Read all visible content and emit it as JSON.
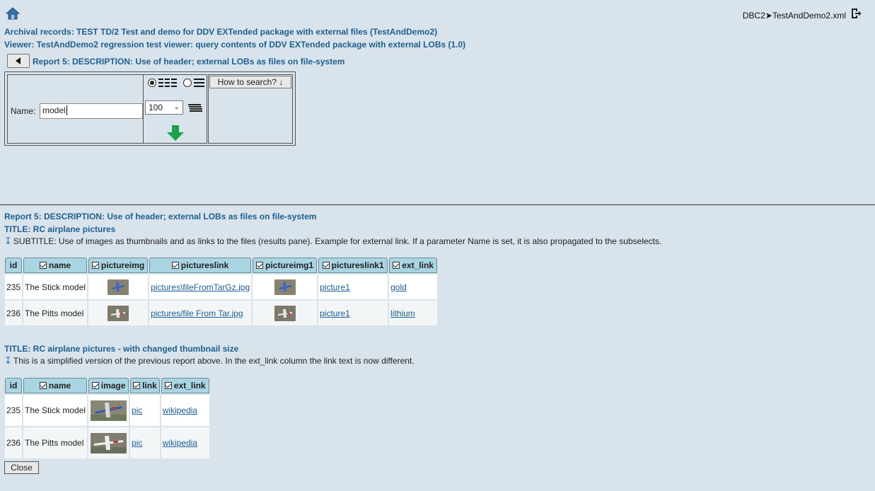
{
  "breadcrumb": "DBC2➤TestAndDemo2.xml",
  "header": {
    "archival": "Archival records: TEST TD/2 Test and demo for DDV EXTended package with external files (TestAndDemo2)",
    "viewer": "Viewer: TestAndDemo2 regression test viewer: query contents of DDV EXTended package with external LOBs (1.0)",
    "report": "Report 5: DESCRIPTION: Use of header; external LOBs as files on file-system"
  },
  "search": {
    "name_label": "Name:",
    "name_value": "model",
    "rows_selected": "100",
    "howto_label": "How to search? ↓"
  },
  "results": {
    "report": "Report 5: DESCRIPTION: Use of header; external LOBs as files on file-system",
    "table1": {
      "title": "TITLE: RC airplane pictures",
      "subtitle": "SUBTITLE: Use of images as thumbnails and as links to the files (results pane). Example for external link. If a parameter Name is set, it is also propagated to the subselects.",
      "columns": [
        "id",
        "name",
        "pictureimg",
        "pictureslink",
        "pictureimg1",
        "pictureslink1",
        "ext_link"
      ],
      "rows": [
        {
          "id": "235",
          "name": "The Stick model",
          "pictureslink": "pictures\\fileFromTarGz.jpg",
          "pictureslink1": "picture1",
          "ext_link": "gold"
        },
        {
          "id": "236",
          "name": "The Pitts model",
          "pictureslink": "pictures/file From Tar.jpg",
          "pictureslink1": "picture1",
          "ext_link": "lithium"
        }
      ]
    },
    "table2": {
      "title": "TITLE: RC airplane pictures - with changed thumbnail size",
      "subtitle": "This is a simplified version of the previous report above. In the ext_link column the link text is now different.",
      "columns": [
        "id",
        "name",
        "image",
        "link",
        "ext_link"
      ],
      "rows": [
        {
          "id": "235",
          "name": "The Stick model",
          "link": "pic",
          "ext_link": "wikipedia"
        },
        {
          "id": "236",
          "name": "The Pitts model",
          "link": "pic",
          "ext_link": "wikipedia"
        }
      ]
    }
  },
  "close_label": "Close",
  "colors": {
    "background": "#d9e3ec",
    "header_text": "#1d5f8f",
    "column_header": "#a9d4e2",
    "link": "#1a5e9a",
    "search_arrow": "#1aa34a"
  }
}
